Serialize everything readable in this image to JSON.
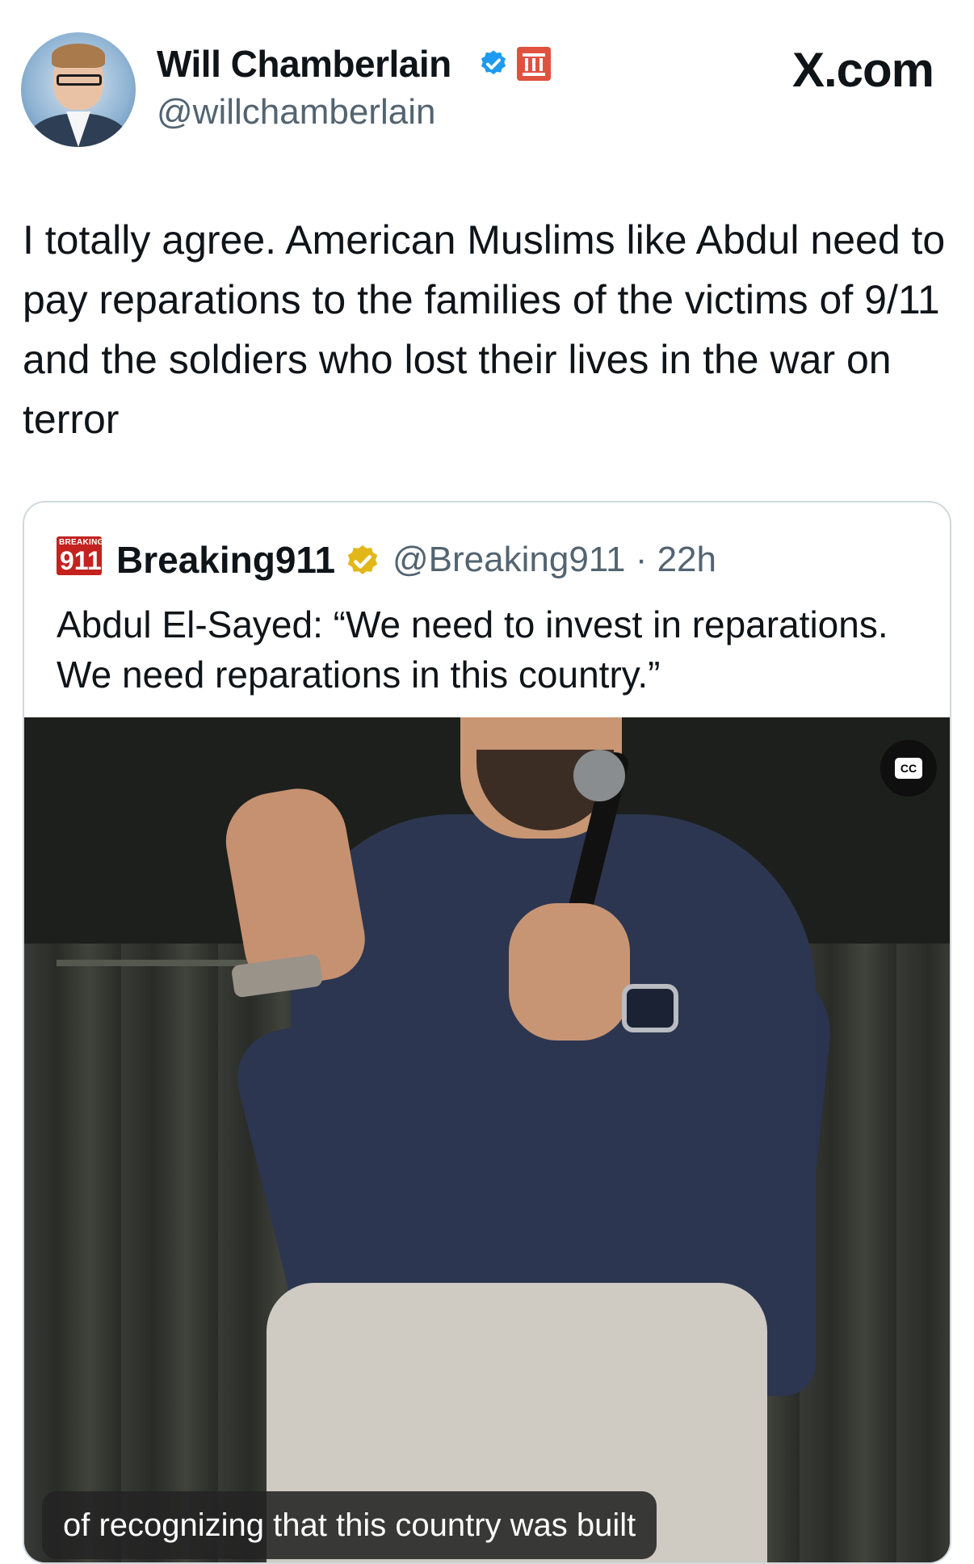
{
  "header": {
    "author_name": "Will Chamberlain",
    "handle": "@willchamberlain",
    "brand": "X.com",
    "affiliate_badge_icon": "government-columns-icon",
    "verified_icon": "blue-verified-icon"
  },
  "tweet": {
    "text": "I totally agree. American Muslims like Abdul need to pay reparations to the families of the victims of 9/11 and the soldiers who lost their lives in the war on terror"
  },
  "quote": {
    "logo_small": "BREAKING",
    "logo_big": "911",
    "name": "Breaking911",
    "handle_time": "@Breaking911 · 22h",
    "verified_icon": "gold-verified-icon",
    "text": "Abdul El-Sayed: “We need to invest in reparations. We need reparations in this country.”",
    "video": {
      "cc_label": "CC",
      "caption": "of recognizing that this country was built"
    }
  },
  "colors": {
    "verified_blue": "#1d9bf0",
    "verified_gold": "#e2b719",
    "affiliate_red": "#e0513f",
    "secondary_text": "#536471"
  }
}
